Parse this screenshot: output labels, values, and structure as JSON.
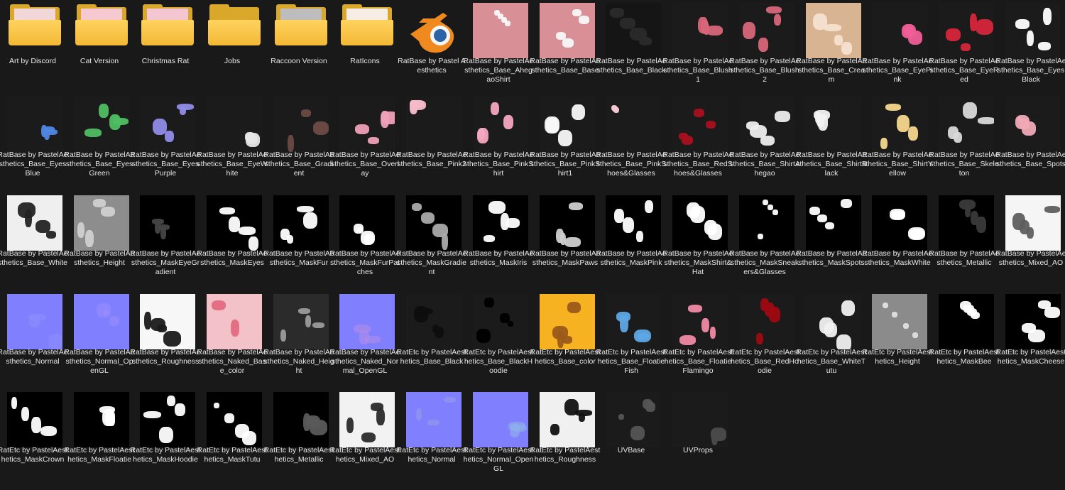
{
  "items": [
    {
      "label": "Art by Discord",
      "kind": "folder",
      "preview": "#f2d7d9",
      "icon": "folder-icon"
    },
    {
      "label": "Cat Version",
      "kind": "folder",
      "preview": "#f6c9d0",
      "icon": "folder-icon"
    },
    {
      "label": "Christmas Rat",
      "kind": "folder",
      "preview": "#f4c6d2",
      "icon": "folder-icon"
    },
    {
      "label": "Jobs",
      "kind": "folder",
      "preview": "",
      "icon": "folder-icon"
    },
    {
      "label": "Raccoon Version",
      "kind": "folder",
      "preview": "#bdbdbd",
      "icon": "folder-icon"
    },
    {
      "label": "RatIcons",
      "kind": "folder",
      "preview": "#f7ede7",
      "icon": "folder-icon"
    },
    {
      "label": "RatBase by Pastel Aesthetics",
      "kind": "blender",
      "icon": "blender-icon"
    },
    {
      "label": "RatBase by PastelAesthetics_Base_AhegaoShirt",
      "kind": "tex",
      "bg": "#d88f96",
      "fg": "#f8f8f8"
    },
    {
      "label": "RatBase by PastelAesthetics_Base_Base",
      "kind": "tex",
      "bg": "#d88f96",
      "fg": "#f8f8f8"
    },
    {
      "label": "RatBase by PastelAesthetics_Base_Black",
      "kind": "tex",
      "bg": "#151515",
      "fg": "#2a2a2a"
    },
    {
      "label": "RatBase by PastelAesthetics_Base_Blush1",
      "kind": "tex",
      "bg": "#1b1b1b",
      "fg": "#d8667a"
    },
    {
      "label": "RatBase by PastelAesthetics_Base_Blush2",
      "kind": "tex",
      "bg": "#1b1b1b",
      "fg": "#d8667a"
    },
    {
      "label": "RatBase by PastelAesthetics_Base_Cream",
      "kind": "tex",
      "bg": "#d9b493",
      "fg": "#f4e2cf"
    },
    {
      "label": "RatBase by PastelAesthetics_Base_EyePink",
      "kind": "tex",
      "bg": "#1b1b1b",
      "fg": "#f05e97"
    },
    {
      "label": "RatBase by PastelAesthetics_Base_EyeRed",
      "kind": "tex",
      "bg": "#1b1b1b",
      "fg": "#d6253a"
    },
    {
      "label": "RatBase by PastelAesthetics_Base_EyesBlack",
      "kind": "tex",
      "bg": "#1b1b1b",
      "fg": "#ffffff"
    },
    {
      "label": "RatBase by PastelAesthetics_Base_EyesBlue",
      "kind": "tex",
      "bg": "#1b1b1b",
      "fg": "#4f86e4"
    },
    {
      "label": "RatBase by PastelAesthetics_Base_EyesGreen",
      "kind": "tex",
      "bg": "#1b1b1b",
      "fg": "#4fbf63"
    },
    {
      "label": "RatBase by PastelAesthetics_Base_EyesPurple",
      "kind": "tex",
      "bg": "#1b1b1b",
      "fg": "#8f8ce6"
    },
    {
      "label": "RatBase by PastelAesthetics_Base_EyeWhite",
      "kind": "tex",
      "bg": "#1b1b1b",
      "fg": "#e6e6e6"
    },
    {
      "label": "RatBase by PastelAesthetics_Base_Gradient",
      "kind": "tex",
      "bg": "#1b1b1b",
      "fg": "#6a4a44"
    },
    {
      "label": "RatBase by PastelAesthetics_Base_Overlay",
      "kind": "tex",
      "bg": "#1b1b1b",
      "fg": "#f0a0b8"
    },
    {
      "label": "RatBase by PastelAesthetics_Base_Pink2",
      "kind": "tex",
      "bg": "#1b1b1b",
      "fg": "#f6b9c9"
    },
    {
      "label": "RatBase by PastelAesthetics_Base_PinkShirt",
      "kind": "tex",
      "bg": "#1b1b1b",
      "fg": "#f4a8c0"
    },
    {
      "label": "RatBase by PastelAesthetics_Base_PinkShirt1",
      "kind": "tex",
      "bg": "#1b1b1b",
      "fg": "#f8f8f8"
    },
    {
      "label": "RatBase by PastelAesthetics_Base_PinkShoes&Glasses",
      "kind": "tex",
      "bg": "#1b1b1b",
      "fg": "#f6c6d2"
    },
    {
      "label": "RatBase by PastelAesthetics_Base_RedShoes&Glasses",
      "kind": "tex",
      "bg": "#1b1b1b",
      "fg": "#a81020"
    },
    {
      "label": "RatBase by PastelAesthetics_Base_ShirtAhegao",
      "kind": "tex",
      "bg": "#1b1b1b",
      "fg": "#ededed"
    },
    {
      "label": "RatBase by PastelAesthetics_Base_ShirtBlack",
      "kind": "tex",
      "bg": "#1b1b1b",
      "fg": "#f2f2f2"
    },
    {
      "label": "RatBase by PastelAesthetics_Base_ShirtYellow",
      "kind": "tex",
      "bg": "#1b1b1b",
      "fg": "#f6d78c"
    },
    {
      "label": "RatBase by PastelAesthetics_Base_Skeleton",
      "kind": "tex",
      "bg": "#1b1b1b",
      "fg": "#d9d9d9"
    },
    {
      "label": "RatBase by PastelAesthetics_Base_Spots",
      "kind": "tex",
      "bg": "#1b1b1b",
      "fg": "#f1a9b6"
    },
    {
      "label": "RatBase by PastelAesthetics_Base_White",
      "kind": "tex",
      "bg": "#efefef",
      "fg": "#232323"
    },
    {
      "label": "RatBase by PastelAesthetics_Height",
      "kind": "tex",
      "bg": "#8d8d8d",
      "fg": "#d0d0d0"
    },
    {
      "label": "RatBase by PastelAesthetics_MaskEyeGradient",
      "kind": "tex",
      "bg": "#000000",
      "fg": "#444444"
    },
    {
      "label": "RatBase by PastelAesthetics_MaskEyes",
      "kind": "tex",
      "bg": "#000000",
      "fg": "#ffffff"
    },
    {
      "label": "RatBase by PastelAesthetics_MaskFur",
      "kind": "tex",
      "bg": "#000000",
      "fg": "#ffffff"
    },
    {
      "label": "RatBase by PastelAesthetics_MaskFurPatches",
      "kind": "tex",
      "bg": "#000000",
      "fg": "#ffffff"
    },
    {
      "label": "RatBase by PastelAesthetics_MaskGradient",
      "kind": "tex",
      "bg": "#000000",
      "fg": "#aaaaaa"
    },
    {
      "label": "RatBase by PastelAesthetics_MaskIris",
      "kind": "tex",
      "bg": "#000000",
      "fg": "#ffffff"
    },
    {
      "label": "RatBase by PastelAesthetics_MaskPaws",
      "kind": "tex",
      "bg": "#000000",
      "fg": "#cfcfcf"
    },
    {
      "label": "RatBase by PastelAesthetics_MaskPink",
      "kind": "tex",
      "bg": "#000000",
      "fg": "#ffffff"
    },
    {
      "label": "RatBase by PastelAesthetics_MaskShirt&Hat",
      "kind": "tex",
      "bg": "#000000",
      "fg": "#ffffff"
    },
    {
      "label": "RatBase by PastelAesthetics_MaskSneakers&Glasses",
      "kind": "tex",
      "bg": "#000000",
      "fg": "#ffffff"
    },
    {
      "label": "RatBase by PastelAesthetics_MaskSpots",
      "kind": "tex",
      "bg": "#000000",
      "fg": "#ffffff"
    },
    {
      "label": "RatBase by PastelAesthetics_MaskWhite",
      "kind": "tex",
      "bg": "#000000",
      "fg": "#ffffff"
    },
    {
      "label": "RatBase by PastelAesthetics_Metallic",
      "kind": "tex",
      "bg": "#000000",
      "fg": "#3a3a3a"
    },
    {
      "label": "RatBase by PastelAesthetics_Mixed_AO",
      "kind": "tex",
      "bg": "#f5f5f5",
      "fg": "#5e5e5e"
    },
    {
      "label": "RatBase by PastelAesthetics_Normal",
      "kind": "normal",
      "bg": "#8080ff",
      "fg": "#8c8cff"
    },
    {
      "label": "RatBase by PastelAesthetics_Normal_OpenGL",
      "kind": "normal",
      "bg": "#8080ff",
      "fg": "#9a8cff"
    },
    {
      "label": "RatBase by PastelAesthetics_Roughness",
      "kind": "tex",
      "bg": "#f7f7f7",
      "fg": "#1a1a1a"
    },
    {
      "label": "RatBase by PastelAesthetics_Naked_Base_color",
      "kind": "tex",
      "bg": "#f2c2c8",
      "fg": "#e46e84"
    },
    {
      "label": "RatBase by PastelAesthetics_Naked_Height",
      "kind": "tex",
      "bg": "#2b2b2b",
      "fg": "#9b9b9b"
    },
    {
      "label": "RatBase by PastelAesthetics_Naked_Normal_OpenGL",
      "kind": "normal",
      "bg": "#8080ff",
      "fg": "#b18ce8"
    },
    {
      "label": "RatEtc by PastelAesthetics_Base_Black",
      "kind": "tex",
      "bg": "#1b1b1b",
      "fg": "#0e0e0e"
    },
    {
      "label": "RatEtc by PastelAesthetics_Base_BlackHoodie",
      "kind": "tex",
      "bg": "#1b1b1b",
      "fg": "#000000"
    },
    {
      "label": "RatEtc by PastelAesthetics_Base_color",
      "kind": "tex",
      "bg": "#f7b221",
      "fg": "#9a5a1a"
    },
    {
      "label": "RatEtc by PastelAesthetics_Base_FloatieFish",
      "kind": "tex",
      "bg": "#1b1b1b",
      "fg": "#5ea6e4"
    },
    {
      "label": "RatEtc by PastelAesthetics_Base_FloatieFlamingo",
      "kind": "tex",
      "bg": "#1b1b1b",
      "fg": "#f28aa4"
    },
    {
      "label": "RatEtc by PastelAesthetics_Base_RedHoodie",
      "kind": "tex",
      "bg": "#1b1b1b",
      "fg": "#9e0a12"
    },
    {
      "label": "RatEtc by PastelAesthetics_Base_WhiteTutu",
      "kind": "tex",
      "bg": "#1b1b1b",
      "fg": "#f0f0f0"
    },
    {
      "label": "RatEtc by PastelAesthetics_Height",
      "kind": "tex",
      "bg": "#8b8b8b",
      "fg": "#e0e0e0"
    },
    {
      "label": "RatEtc by PastelAesthetics_MaskBee",
      "kind": "tex",
      "bg": "#000000",
      "fg": "#ffffff"
    },
    {
      "label": "RatEtc by PastelAesthetics_MaskCheese",
      "kind": "tex",
      "bg": "#000000",
      "fg": "#ffffff"
    },
    {
      "label": "RatEtc by PastelAesthetics_MaskCrown",
      "kind": "tex",
      "bg": "#000000",
      "fg": "#ffffff"
    },
    {
      "label": "RatEtc by PastelAesthetics_MaskFloatie",
      "kind": "tex",
      "bg": "#000000",
      "fg": "#ffffff"
    },
    {
      "label": "RatEtc by PastelAesthetics_MaskHoodie",
      "kind": "tex",
      "bg": "#000000",
      "fg": "#ffffff"
    },
    {
      "label": "RatEtc by PastelAesthetics_MaskTutu",
      "kind": "tex",
      "bg": "#000000",
      "fg": "#ffffff"
    },
    {
      "label": "RatEtc by PastelAesthetics_Metallic",
      "kind": "tex",
      "bg": "#000000",
      "fg": "#5a5a5a"
    },
    {
      "label": "RatEtc by PastelAesthetics_Mixed_AO",
      "kind": "tex",
      "bg": "#f2f2f2",
      "fg": "#2a2a2a"
    },
    {
      "label": "RatEtc by PastelAesthetics_Normal",
      "kind": "normal",
      "bg": "#8080ff",
      "fg": "#9a9ae6"
    },
    {
      "label": "RatEtc by PastelAesthetics_Normal_OpenGL",
      "kind": "normal",
      "bg": "#8080ff",
      "fg": "#8fb0ea"
    },
    {
      "label": "RatEtc by PastelAesthetics_Roughness",
      "kind": "tex",
      "bg": "#f0f0f0",
      "fg": "#111111"
    },
    {
      "label": "UVBase",
      "kind": "uv",
      "bg": "#1b1b1b",
      "fg": "#555555"
    },
    {
      "label": "UVProps",
      "kind": "uv",
      "bg": "#1b1b1b",
      "fg": "#4a4a4a"
    }
  ]
}
